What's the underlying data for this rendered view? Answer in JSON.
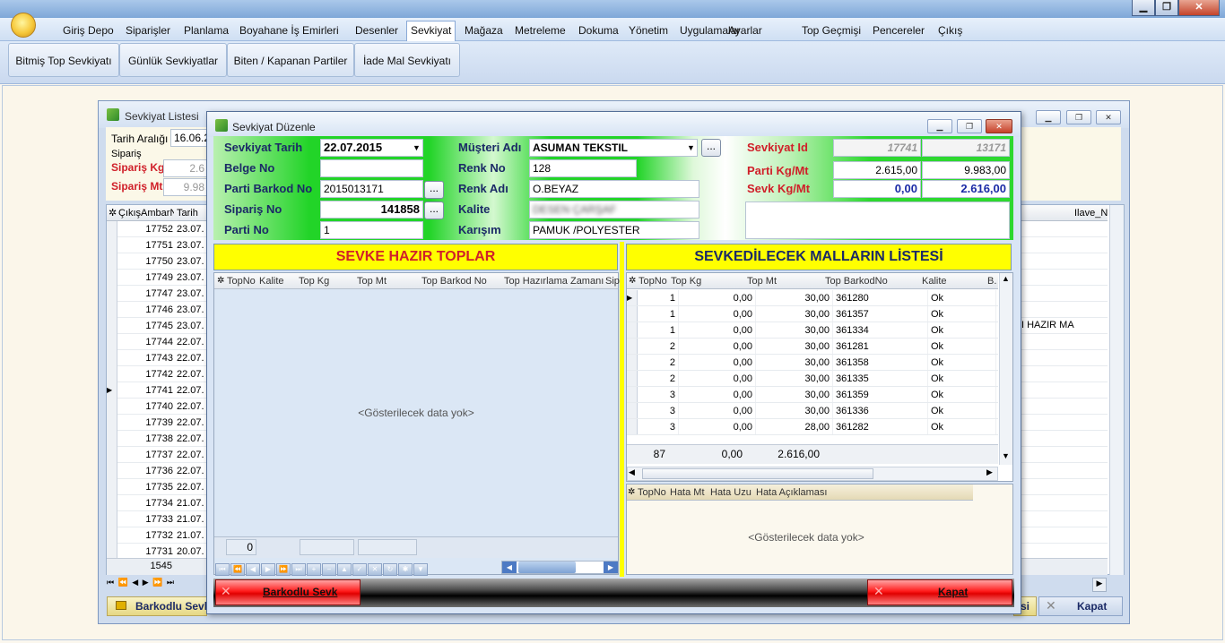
{
  "app": {
    "window_controls": {
      "min": "▁",
      "max": "❐",
      "close": "✕"
    }
  },
  "menu": {
    "items": [
      "Giriş Depo",
      "Siparişler",
      "Planlama",
      "Boyahane İş Emirleri",
      "Desenler",
      "Sevkiyat",
      "Mağaza",
      "Metreleme",
      "Dokuma",
      "Yönetim",
      "Uygulamalar",
      "Ayarlar",
      "Top Geçmişi",
      "Pencereler",
      "Çıkış"
    ],
    "active": "Sevkiyat"
  },
  "ribbon": {
    "buttons": [
      "Bitmiş Top Sevkiyatı",
      "Günlük Sevkiyatlar",
      "Biten / Kapanan Partiler",
      "İade Mal Sevkiyatı"
    ]
  },
  "bgwin": {
    "title": "Sevkiyat Listesi",
    "tarih_label": "Tarih Aralığı",
    "tarih_value": "16.06.2",
    "siparis_group": "Sipariş",
    "siparis_kg_label": "Sipariş Kg",
    "siparis_kg": "2.6",
    "siparis_mt_label": "Sipariş Mt",
    "siparis_mt": "9.98",
    "col_cikis": "ÇıkışAmbarNo",
    "col_tarih": "Tarih",
    "col_ilave": "Ilave_N",
    "rows": [
      [
        "17752",
        "23.07."
      ],
      [
        "17751",
        "23.07."
      ],
      [
        "17750",
        "23.07."
      ],
      [
        "17749",
        "23.07."
      ],
      [
        "17747",
        "23.07."
      ],
      [
        "17746",
        "23.07."
      ],
      [
        "17745",
        "23.07."
      ],
      [
        "17744",
        "22.07."
      ],
      [
        "17743",
        "22.07."
      ],
      [
        "17742",
        "22.07."
      ],
      [
        "17741",
        "22.07."
      ],
      [
        "17740",
        "22.07."
      ],
      [
        "17739",
        "22.07."
      ],
      [
        "17738",
        "22.07."
      ],
      [
        "17737",
        "22.07."
      ],
      [
        "17736",
        "22.07."
      ],
      [
        "17735",
        "22.07."
      ],
      [
        "17734",
        "21.07."
      ],
      [
        "17733",
        "21.07."
      ],
      [
        "17732",
        "21.07."
      ],
      [
        "17731",
        "20.07."
      ]
    ],
    "right_note": "I HAZIR MA",
    "footer_count": "1545",
    "barkodlu_label": "Barkodlu Sevk",
    "kapat_label": "Kapat",
    "right_partial": "si"
  },
  "dialog": {
    "title": "Sevkiyat Düzenle",
    "sevkiyat_tarih_label": "Sevkiyat Tarih",
    "sevkiyat_tarih": "22.07.2015",
    "belge_no_label": "Belge No",
    "belge_no": "",
    "parti_barkod_label": "Parti Barkod No",
    "parti_barkod": "2015013171",
    "siparis_no_label": "Sipariş No",
    "siparis_no": "141858",
    "parti_no_label": "Parti No",
    "parti_no": "1",
    "musteri_label": "Müşteri Adı",
    "musteri": "ASUMAN TEKSTIL",
    "renk_no_label": "Renk No",
    "renk_no": "128",
    "renk_adi_label": "Renk Adı",
    "renk_adi": "O.BEYAZ",
    "kalite_label": "Kalite",
    "kalite": "DESEN ÇARŞAF",
    "karisim_label": "Karışım",
    "karisim": "PAMUK /POLYESTER",
    "sevkiyat_id_label": "Sevkiyat Id",
    "sevkiyat_id": "17741",
    "sevkiyat_id2": "13171",
    "parti_kgmt_label": "Parti  Kg/Mt",
    "parti_kg": "2.615,00",
    "parti_mt": "9.983,00",
    "sevk_kgmt_label": "Sevk  Kg/Mt",
    "sevk_kg": "0,00",
    "sevk_mt": "2.616,00",
    "ellipsis": "...",
    "left_header": "SEVKE HAZIR TOPLAR",
    "left_cols": [
      "TopNo",
      "Kalite",
      "Top Kg",
      "Top Mt",
      "Top Barkod No",
      "Top Hazırlama Zamanı",
      "Sip"
    ],
    "no_data": "<Gösterilecek data yok>",
    "left_footer_count": "0",
    "right_header": "SEVKEDİLECEK MALLARIN LİSTESİ",
    "right_cols": [
      "TopNo",
      "Top Kg",
      "Top Mt",
      "Top BarkodNo",
      "Kalite",
      "B."
    ],
    "right_rows": [
      [
        "1",
        "0,00",
        "30,00",
        "361280",
        "Ok"
      ],
      [
        "1",
        "0,00",
        "30,00",
        "361357",
        "Ok"
      ],
      [
        "1",
        "0,00",
        "30,00",
        "361334",
        "Ok"
      ],
      [
        "2",
        "0,00",
        "30,00",
        "361281",
        "Ok"
      ],
      [
        "2",
        "0,00",
        "30,00",
        "361358",
        "Ok"
      ],
      [
        "2",
        "0,00",
        "30,00",
        "361335",
        "Ok"
      ],
      [
        "3",
        "0,00",
        "30,00",
        "361359",
        "Ok"
      ],
      [
        "3",
        "0,00",
        "30,00",
        "361336",
        "Ok"
      ],
      [
        "3",
        "0,00",
        "28,00",
        "361282",
        "Ok"
      ]
    ],
    "right_footer": {
      "count": "87",
      "kg": "0,00",
      "mt": "2.616,00"
    },
    "err_cols": [
      "TopNo",
      "Hata Mt",
      "Hata Uzu",
      "Hata Açıklaması"
    ],
    "barkodlu_sevk": "Barkodlu Sevk",
    "kapat": "Kapat"
  }
}
